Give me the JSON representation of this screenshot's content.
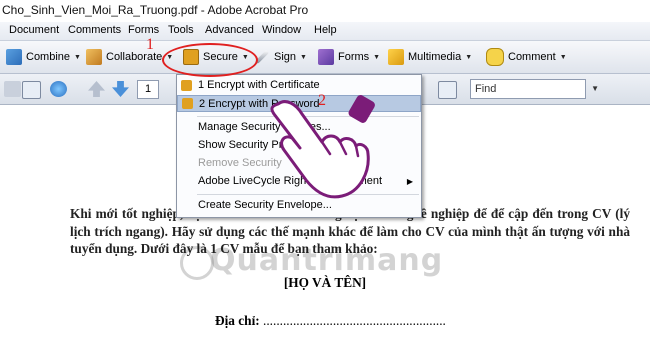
{
  "window": {
    "title": "Cho_Sinh_Vien_Moi_Ra_Truong.pdf - Adobe Acrobat Pro"
  },
  "menu": [
    "Document",
    "Comments",
    "Forms",
    "Tools",
    "Advanced",
    "Window",
    "Help"
  ],
  "toolbar": {
    "combine": "Combine",
    "collaborate": "Collaborate",
    "secure": "Secure",
    "sign": "Sign",
    "forms": "Forms",
    "multimedia": "Multimedia",
    "comment": "Comment"
  },
  "nav": {
    "page_number": "1",
    "find_placeholder": "Find"
  },
  "secure_menu": {
    "items": [
      {
        "label": "1 Encrypt with Certificate",
        "enabled": true
      },
      {
        "label": "2 Encrypt with Password",
        "enabled": true,
        "highlighted": true
      },
      {
        "label": "Manage Security Policies...",
        "enabled": true
      },
      {
        "label": "Show Security Properties",
        "enabled": true
      },
      {
        "label": "Remove Security",
        "enabled": false
      },
      {
        "label": "Adobe LiveCycle Rights Management",
        "enabled": true,
        "submenu": true
      },
      {
        "label": "Create Security Envelope...",
        "enabled": true
      }
    ]
  },
  "annotations": {
    "step1": "1",
    "step2": "2"
  },
  "document": {
    "paragraph": "Khi mới tốt nghiệp, bạn chưa có nhiều kinh nghiệm làm nghề nghiệp để để cập đến trong CV (lý lịch trích ngang). Hãy sử dụng các thế mạnh khác để làm cho CV của mình thật ấn tượng với nhà tuyển dụng. Dưới đây là 1 CV mẫu để bạn tham khảo:",
    "heading": "[HỌ VÀ TÊN]",
    "address_label": "Địa chỉ:",
    "address_value": " ......................................................."
  },
  "watermark": "Quantrimang",
  "colors": {
    "highlight": "#b7c9e2",
    "annotation": "#e02020",
    "secure_lock": "#e0a020"
  }
}
